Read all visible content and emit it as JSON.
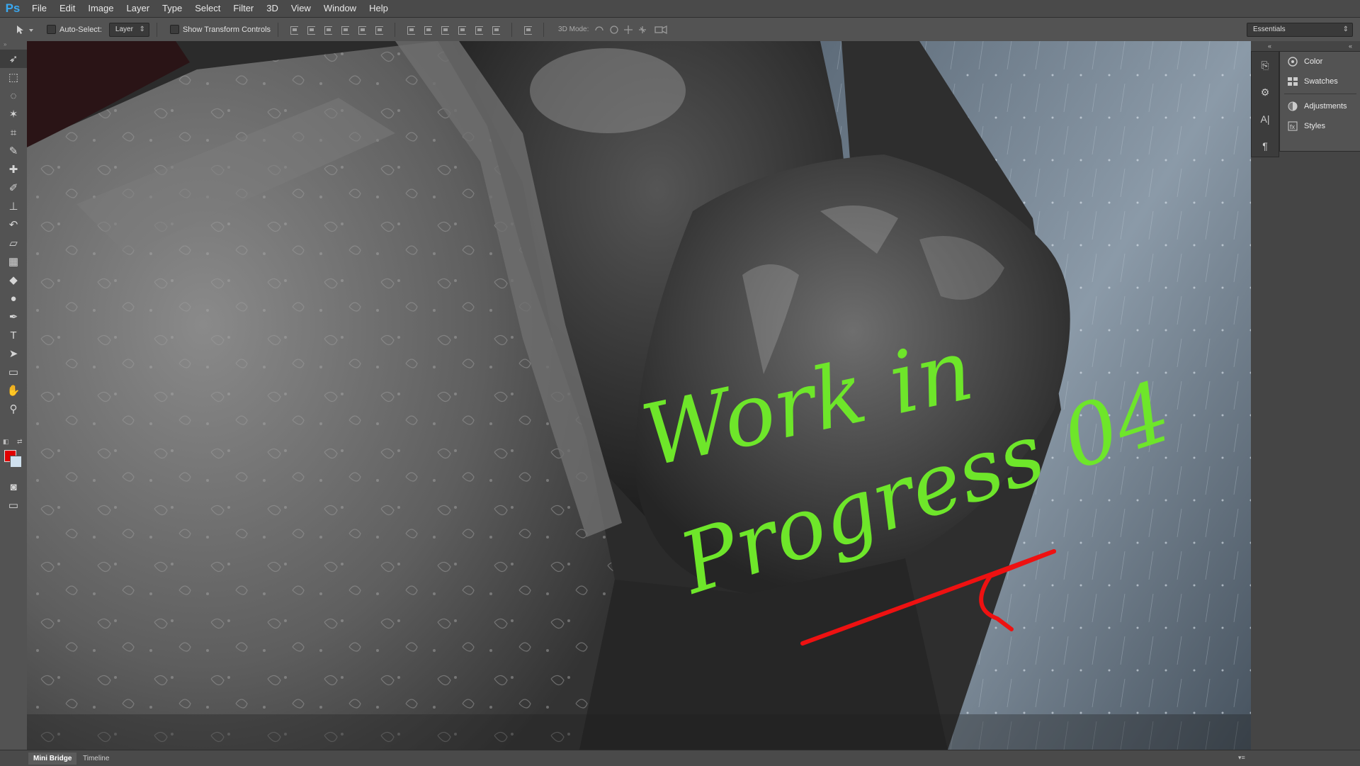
{
  "app": {
    "logo": "Ps"
  },
  "menu": [
    "File",
    "Edit",
    "Image",
    "Layer",
    "Type",
    "Select",
    "Filter",
    "3D",
    "View",
    "Window",
    "Help"
  ],
  "options": {
    "auto_select_label": "Auto-Select:",
    "auto_select_value": "Layer",
    "show_transform_label": "Show Transform Controls",
    "mode_3d_label": "3D Mode:",
    "workspace": "Essentials"
  },
  "tools": [
    {
      "name": "move-tool",
      "icon": "move-icon",
      "glyph": "➶"
    },
    {
      "name": "marquee-tool",
      "icon": "marquee-icon",
      "glyph": "⬚"
    },
    {
      "name": "lasso-tool",
      "icon": "lasso-icon",
      "glyph": "◌"
    },
    {
      "name": "magic-wand-tool",
      "icon": "magic-wand-icon",
      "glyph": "✶"
    },
    {
      "name": "crop-tool",
      "icon": "crop-icon",
      "glyph": "⌗"
    },
    {
      "name": "eyedropper-tool",
      "icon": "eyedropper-icon",
      "glyph": "✎"
    },
    {
      "name": "healing-brush-tool",
      "icon": "bandage-icon",
      "glyph": "✚"
    },
    {
      "name": "brush-tool",
      "icon": "brush-icon",
      "glyph": "✐"
    },
    {
      "name": "clone-stamp-tool",
      "icon": "stamp-icon",
      "glyph": "⊥"
    },
    {
      "name": "history-brush-tool",
      "icon": "history-brush-icon",
      "glyph": "↶"
    },
    {
      "name": "eraser-tool",
      "icon": "eraser-icon",
      "glyph": "▱"
    },
    {
      "name": "gradient-tool",
      "icon": "gradient-icon",
      "glyph": "▦"
    },
    {
      "name": "blur-tool",
      "icon": "drop-icon",
      "glyph": "◆"
    },
    {
      "name": "dodge-tool",
      "icon": "dodge-icon",
      "glyph": "●"
    },
    {
      "name": "pen-tool",
      "icon": "pen-icon",
      "glyph": "✒"
    },
    {
      "name": "type-tool",
      "icon": "type-icon",
      "glyph": "T"
    },
    {
      "name": "path-selection-tool",
      "icon": "path-select-icon",
      "glyph": "➤"
    },
    {
      "name": "shape-tool",
      "icon": "rectangle-icon",
      "glyph": "▭"
    },
    {
      "name": "hand-tool",
      "icon": "hand-icon",
      "glyph": "✋"
    },
    {
      "name": "zoom-tool",
      "icon": "zoom-icon",
      "glyph": "⚲"
    }
  ],
  "colors": {
    "foreground": "#e00000",
    "background": "#cfe0ee"
  },
  "dock_icons": [
    {
      "name": "history-icon",
      "glyph": "⎘"
    },
    {
      "name": "properties-icon",
      "glyph": "⚙"
    },
    {
      "name": "character-icon",
      "glyph": "A|"
    },
    {
      "name": "paragraph-icon",
      "glyph": "¶"
    }
  ],
  "panels": [
    "Color",
    "Swatches",
    "Adjustments",
    "Styles"
  ],
  "canvas": {
    "annotation_line1": "Work in",
    "annotation_line2": "Progress 04",
    "annotation_color": "#6ee62a",
    "arrow_color": "#ee1111"
  },
  "bottom_tabs": [
    "Mini Bridge",
    "Timeline"
  ]
}
